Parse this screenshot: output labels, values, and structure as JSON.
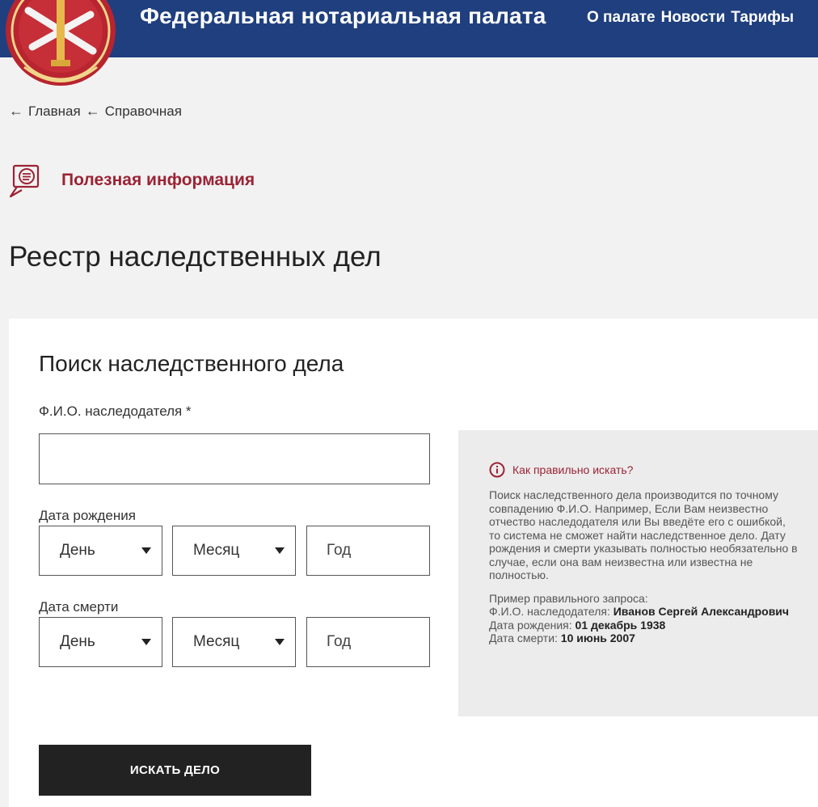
{
  "header": {
    "site_title": "Федеральная нотариальная палата",
    "nav": [
      "О палате",
      "Новости",
      "Тарифы"
    ],
    "bg_color": "#1f3f7e"
  },
  "breadcrumb": {
    "items": [
      "Главная",
      "Справочная"
    ],
    "separator": "←"
  },
  "section": {
    "title": "Полезная информация",
    "icon": "document-chat-icon",
    "accent_color": "#9b2335"
  },
  "page_title": "Реестр наследственных дел",
  "form": {
    "title": "Поиск наследственного дела",
    "name_label": "Ф.И.О. наследодателя *",
    "name_value": "",
    "birth_label": "Дата рождения",
    "death_label": "Дата смерти",
    "day_placeholder": "День",
    "month_placeholder": "Месяц",
    "year_placeholder": "Год",
    "submit_label": "ИСКАТЬ ДЕЛО"
  },
  "hint": {
    "title": "Как правильно искать?",
    "text": "Поиск наследственного дела производится по точному совпадению Ф.И.О. Например, Если Вам неизвестно отчество наследодателя или Вы введёте его с ошибкой, то система не сможет найти наследственное дело. Дату рождения и смерти указывать полностью необязательно в случае, если она вам неизвестна или известна не полностью.",
    "example_title": "Пример правильного запроса:",
    "example_name_label": "Ф.И.О. наследодателя: ",
    "example_name_value": "Иванов Сергей Александрович",
    "example_birth_label": "Дата рождения: ",
    "example_birth_value": "01 декабрь 1938",
    "example_death_label": "Дата смерти: ",
    "example_death_value": "10 июнь 2007"
  }
}
